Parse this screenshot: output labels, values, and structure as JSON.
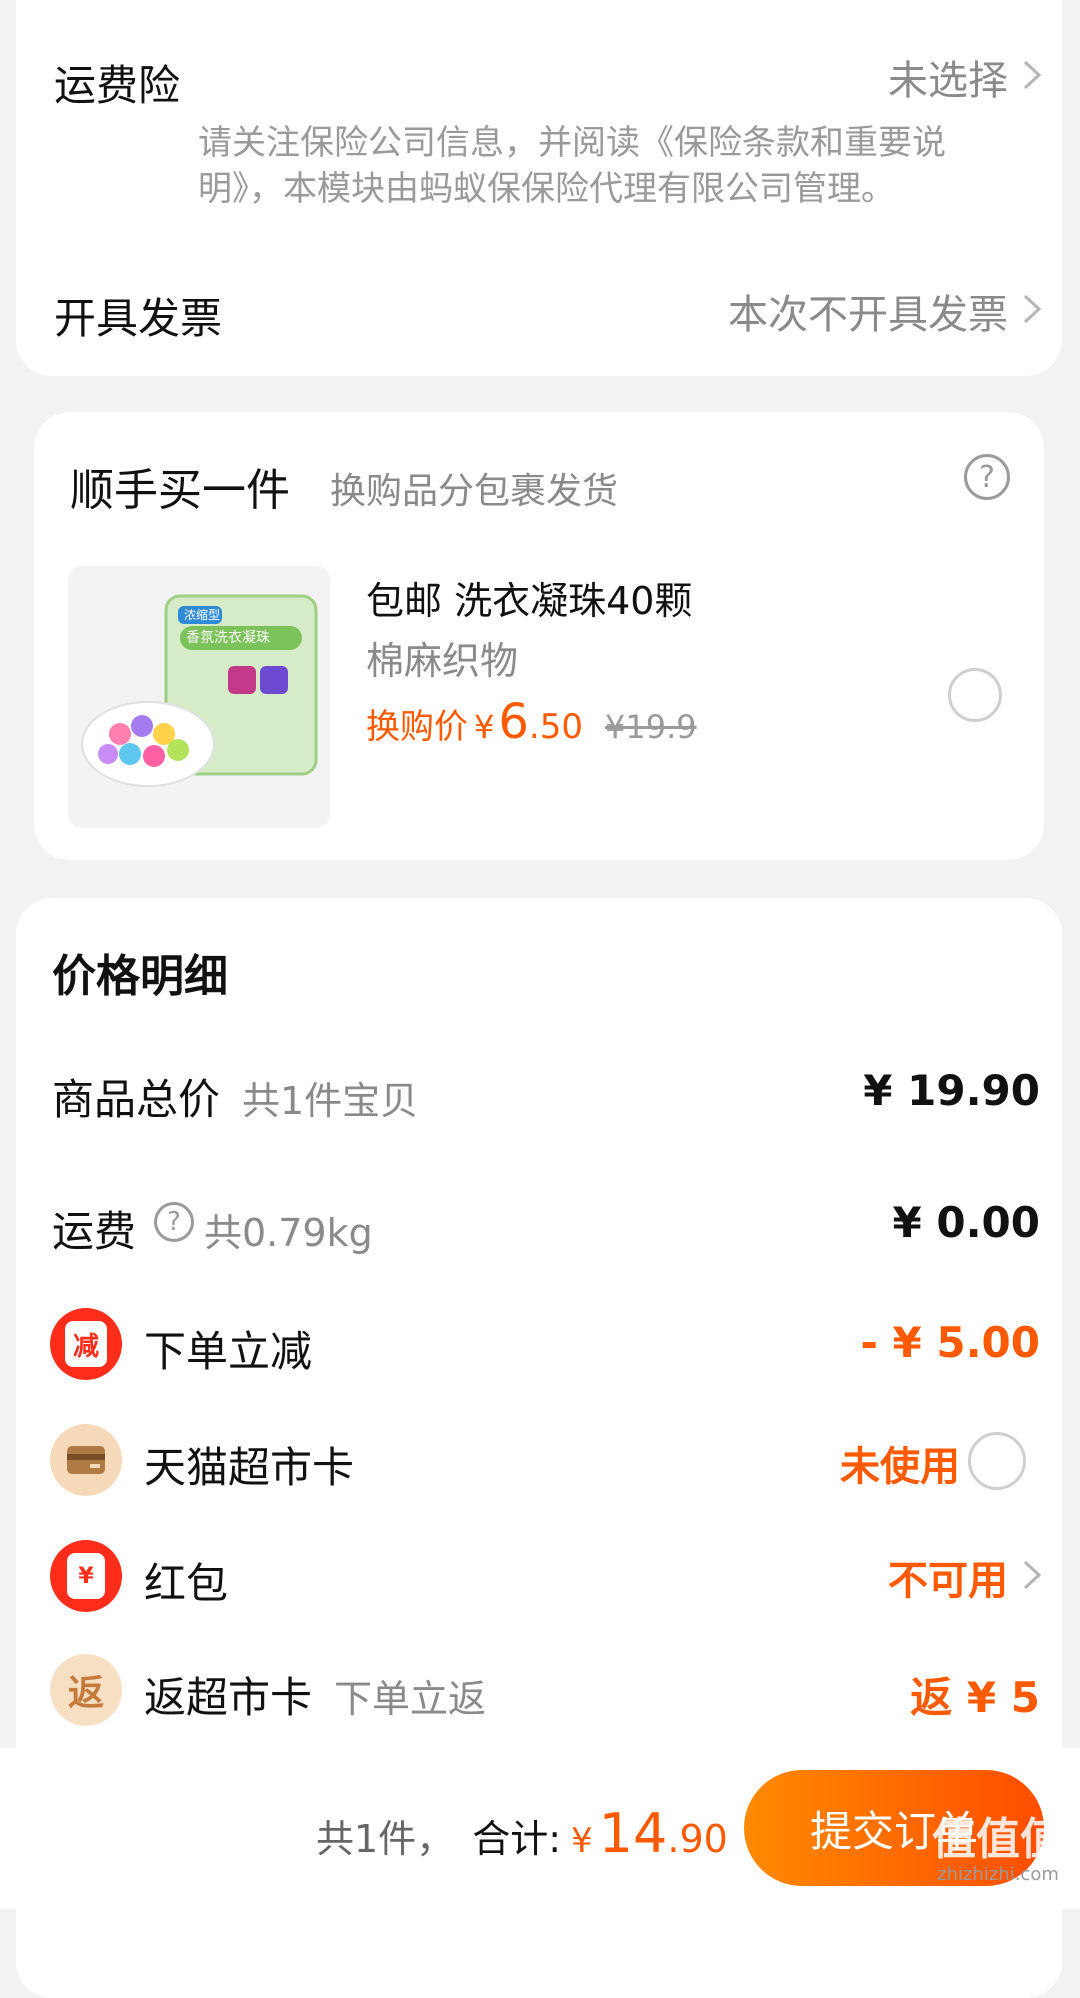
{
  "shipping_insurance": {
    "label": "运费险",
    "value": "未选择",
    "note_line1": "请关注保险公司信息，并阅读《保险条款和重要说",
    "note_line2": "明》，本模块由蚂蚁保保险代理有限公司管理。"
  },
  "invoice": {
    "label": "开具发票",
    "value": "本次不开具发票"
  },
  "addon": {
    "title": "顺手买一件",
    "subtitle": "换购品分包裹发货",
    "product": {
      "name": "包邮 洗衣凝珠40颗",
      "spec": "棉麻织物",
      "price_label": "换购价",
      "currency": "¥",
      "price_int": "6",
      "price_dec": ".50",
      "original_price": "¥19.9",
      "package_brand": "浓缩型",
      "package_name": "香氛洗衣凝珠"
    }
  },
  "price_detail": {
    "title": "价格明细",
    "goods_total_label": "商品总价",
    "goods_count": "共1件宝贝",
    "goods_total_value": "¥ 19.90",
    "shipping_label": "运费",
    "shipping_weight": "共0.79kg",
    "shipping_value": "¥ 0.00",
    "discount_label": "下单立减",
    "discount_icon_text": "减",
    "discount_value": "- ¥ 5.00",
    "tmall_card_label": "天猫超市卡",
    "tmall_card_value": "未使用",
    "redpacket_label": "红包",
    "redpacket_icon_text": "¥",
    "redpacket_value": "不可用",
    "cashback_label": "返超市卡",
    "cashback_icon_text": "返",
    "cashback_note": "下单立返",
    "cashback_value": "返 ¥ 5"
  },
  "footer": {
    "count": "共1件，",
    "total_label": "合计:",
    "currency": "¥",
    "total_int": "14",
    "total_dec": ".90",
    "submit": "提交订单"
  },
  "watermark": {
    "text": "值值值",
    "url": "zhizhizhi.com"
  },
  "colors": {
    "accent": "#ff5a00",
    "red": "#ff2d1a",
    "gold": "#f5d9b8"
  }
}
